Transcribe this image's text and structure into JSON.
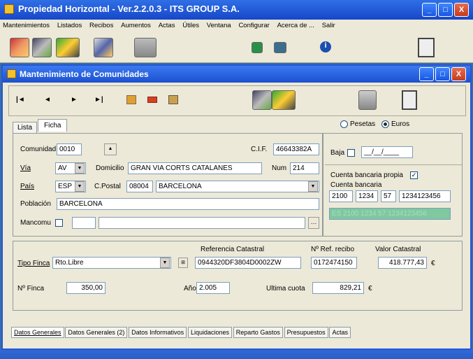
{
  "app": {
    "title": "Propiedad Horizontal - Ver.2.2.0.3 - ITS GROUP S.A.",
    "minimize": "_",
    "maximize": "□",
    "close": "X"
  },
  "menu": [
    "Mantenimientos",
    "Listados",
    "Recibos",
    "Aumentos",
    "Actas",
    "Útiles",
    "Ventana",
    "Configurar",
    "Acerca de ...",
    "Salir"
  ],
  "child": {
    "title": "Mantenimiento de Comunidades"
  },
  "nav": {
    "first": "|◄",
    "prev": "◄",
    "next": "►",
    "last": "►|"
  },
  "tabs": {
    "lista": "Lista",
    "ficha": "Ficha"
  },
  "currency": {
    "pesetas": "Pesetas",
    "euros": "Euros",
    "selected": "Euros"
  },
  "form": {
    "comunidad_label": "Comunidad",
    "comunidad": "0010",
    "cif_label": "C.I.F.",
    "cif": "46643382A",
    "baja_label": "Baja",
    "baja_date": "__/__/____",
    "via_label": "Vía",
    "via": "AV",
    "domicilio_label": "Domicilio",
    "domicilio": "GRAN VIA CORTS CATALANES",
    "num_label": "Num",
    "num": "214",
    "pais_label": "País",
    "pais": "ESP",
    "cpostal_label": "C.Postal",
    "cpostal": "08004",
    "ciudad": "BARCELONA",
    "poblacion_label": "Población",
    "poblacion": "BARCELONA",
    "mancomu_label": "Mancomu",
    "cuenta_propia_label": "Cuenta bancaria propia",
    "cuenta_label": "Cuenta bancaria",
    "cuenta": [
      "2100",
      "1234",
      "57",
      "1234123456"
    ],
    "iban_mask": "ES 2100 1234 57 1234123456",
    "ref_catastral_label": "Referencia Catastral",
    "ref_recibo_label": "Nº Ref. recibo",
    "valor_catastral_label": "Valor Catastral",
    "tipo_finca_label": "Tipo Finca",
    "tipo_finca": "Rto.Libre",
    "ref_catastral": "0944320DF3804D0002ZW",
    "ref_recibo": "0172474150",
    "valor_catastral": "418.777,43",
    "euro": "€",
    "n_finca_label": "Nº Finca",
    "n_finca": "350,00",
    "anio_label": "Año",
    "anio": "2.005",
    "ultima_cuota_label": "Ultima cuota",
    "ultima_cuota": "829,21"
  },
  "bottom_tabs": [
    "Datos Generales",
    "Datos Generales (2)",
    "Datos Informativos",
    "Liquidaciones",
    "Reparto Gastos",
    "Presupuestos",
    "Actas"
  ]
}
